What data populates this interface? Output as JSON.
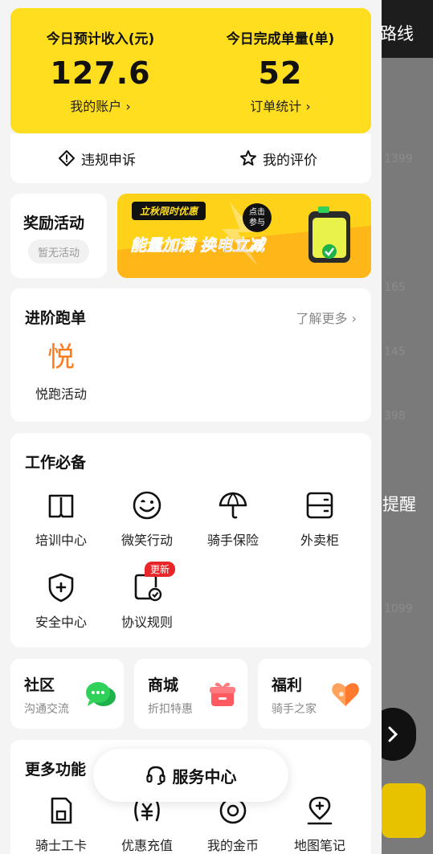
{
  "background": {
    "title_partial": "路线",
    "reminder_partial": "提醒"
  },
  "stats": {
    "income_label": "今日预计收入(元)",
    "income_value": "127.6",
    "account_link": "我的账户 ›",
    "orders_label": "今日完成单量(单)",
    "orders_value": "52",
    "orders_link": "订单统计 ›"
  },
  "actions": {
    "appeal": "违规申诉",
    "rating": "我的评价"
  },
  "rewards": {
    "title": "奖励活动",
    "empty": "暂无活动",
    "banner_tag": "立秋限时优惠",
    "banner_badge_line1": "点击",
    "banner_badge_line2": "参与",
    "banner_text": "能量加满 换电立减"
  },
  "advanced": {
    "title": "进阶跑单",
    "more": "了解更多 ›",
    "item_glyph": "悦",
    "item_label": "悦跑活动"
  },
  "essentials": {
    "title": "工作必备",
    "items": [
      {
        "label": "培训中心",
        "icon": "book-icon"
      },
      {
        "label": "微笑行动",
        "icon": "smile-icon"
      },
      {
        "label": "骑手保险",
        "icon": "umbrella-icon"
      },
      {
        "label": "外卖柜",
        "icon": "locker-icon"
      },
      {
        "label": "安全中心",
        "icon": "shield-icon"
      },
      {
        "label": "协议规则",
        "icon": "agreement-icon"
      }
    ],
    "badge": "更新"
  },
  "cards": [
    {
      "title": "社区",
      "sub": "沟通交流",
      "icon": "chat-icon"
    },
    {
      "title": "商城",
      "sub": "折扣特惠",
      "icon": "gift-icon"
    },
    {
      "title": "福利",
      "sub": "骑手之家",
      "icon": "heart-icon"
    }
  ],
  "more": {
    "title": "更多功能",
    "items": [
      {
        "label": "骑士工卡",
        "icon": "badge-icon"
      },
      {
        "label": "优惠充值",
        "icon": "coupon-icon"
      },
      {
        "label": "我的金币",
        "icon": "coin-icon"
      },
      {
        "label": "地图笔记",
        "icon": "map-pin-icon"
      }
    ]
  },
  "service": {
    "label": "服务中心"
  },
  "colors": {
    "accent_yellow": "#ffde1f",
    "orange": "#ff7a1a",
    "badge_red": "#e8262a",
    "chat_green": "#2fd158",
    "gift_red": "#ff5a5f",
    "heart_orange": "#ff8a3d"
  }
}
